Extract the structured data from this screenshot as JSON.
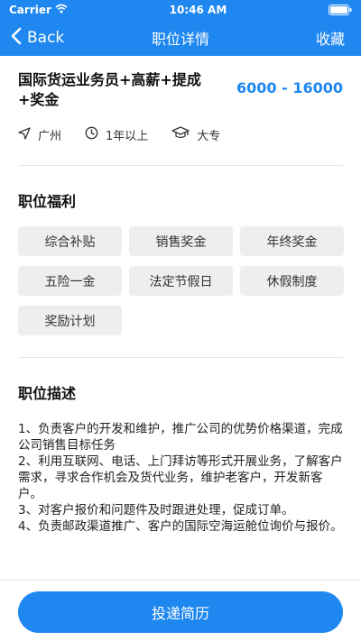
{
  "status_bar": {
    "carrier": "Carrier",
    "time": "10:46 AM"
  },
  "nav": {
    "back_label": "Back",
    "title": "职位详情",
    "favorite_label": "收藏"
  },
  "job": {
    "title": "国际货运业务员+高薪+提成+奖金",
    "salary": "6000 - 16000",
    "location": "广州",
    "experience": "1年以上",
    "education": "大专"
  },
  "benefits": {
    "title": "职位福利",
    "tags": [
      "综合补贴",
      "销售奖金",
      "年终奖金",
      "五险一金",
      "法定节假日",
      "休假制度",
      "奖励计划"
    ]
  },
  "description": {
    "title": "职位描述",
    "lines": [
      "1、负责客户的开发和维护，推广公司的优势价格渠道，完成公司销售目标任务",
      "2、利用互联网、电话、上门拜访等形式开展业务，了解客户需求，寻求合作机会及货代业务，维护老客户，开发新客户。",
      "3、对客户报价和问题件及时跟进处理，促成订单。",
      "4、负责邮政渠道推广、客户的国际空海运舱位询价与报价。"
    ]
  },
  "apply": {
    "label": "投递简历"
  },
  "colors": {
    "primary": "#1e87f0",
    "tag_bg": "#eeeeee"
  },
  "icons": {
    "location": "location-arrow-icon",
    "experience": "clock-icon",
    "education": "graduation-cap-icon"
  }
}
